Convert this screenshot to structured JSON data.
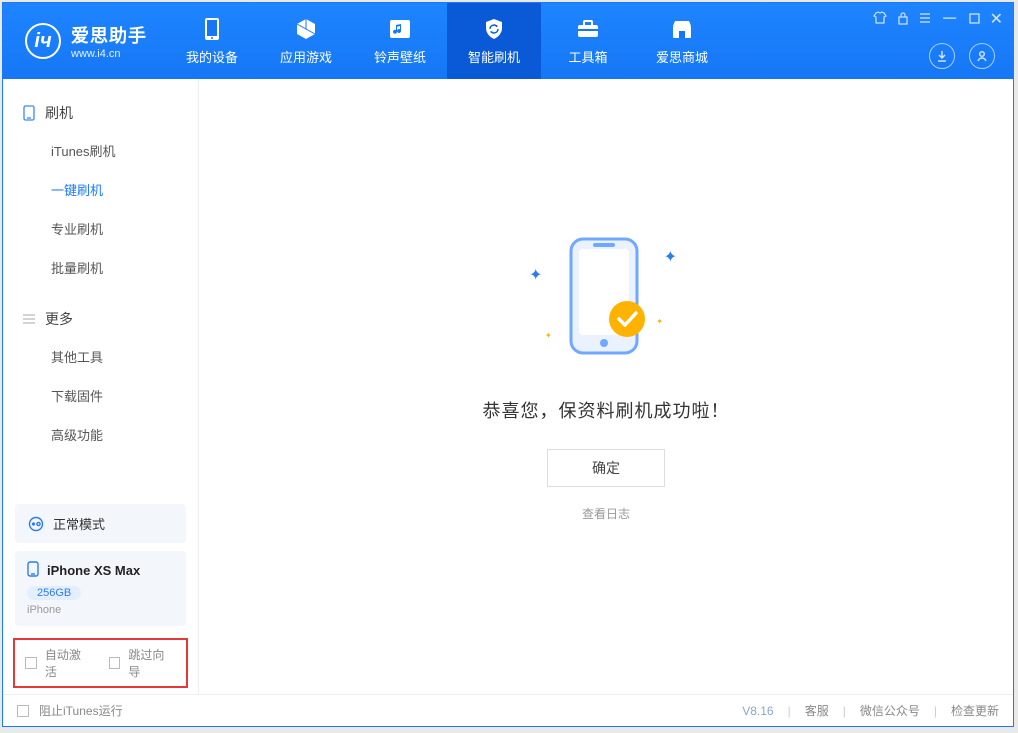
{
  "app": {
    "name": "爱思助手",
    "subtitle": "www.i4.cn"
  },
  "tabs": {
    "device": "我的设备",
    "apps": "应用游戏",
    "ring": "铃声壁纸",
    "flash": "智能刷机",
    "toolbox": "工具箱",
    "store": "爱思商城"
  },
  "sidebar": {
    "group1": "刷机",
    "items1": {
      "itunes": "iTunes刷机",
      "oneclick": "一键刷机",
      "pro": "专业刷机",
      "batch": "批量刷机"
    },
    "group2": "更多",
    "items2": {
      "other": "其他工具",
      "firmware": "下载固件",
      "advanced": "高级功能"
    }
  },
  "device": {
    "mode": "正常模式",
    "name": "iPhone XS Max",
    "storage": "256GB",
    "type": "iPhone"
  },
  "options": {
    "auto_activate": "自动激活",
    "skip_guide": "跳过向导"
  },
  "main": {
    "message": "恭喜您，保资料刷机成功啦！",
    "ok": "确定",
    "view_log": "查看日志"
  },
  "footer": {
    "block_itunes": "阻止iTunes运行",
    "version": "V8.16",
    "service": "客服",
    "wechat": "微信公众号",
    "update": "检查更新"
  }
}
